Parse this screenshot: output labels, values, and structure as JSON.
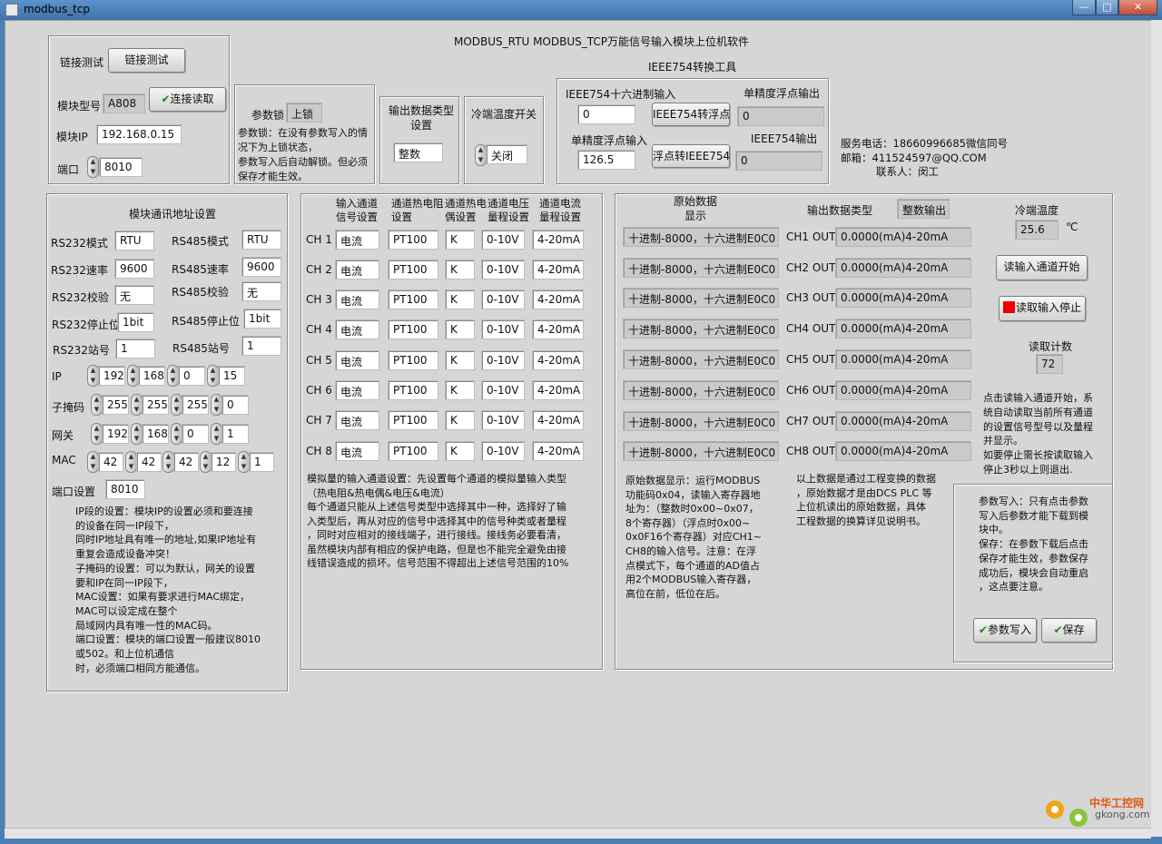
{
  "window": {
    "title": "modbus_tcp",
    "min": "—",
    "max": "□",
    "close": "✕"
  },
  "app_title": "MODBUS_RTU MODBUS_TCP万能信号输入模块上位机软件",
  "conn": {
    "test_label": "链接测试",
    "test_btn": "链接测试",
    "model_label": "模块型号",
    "model": "A808",
    "read_btn": "连接读取",
    "ip_label": "模块IP",
    "ip": "192.168.0.15",
    "port_label": "端口",
    "port": "8010"
  },
  "lock": {
    "label": "参数锁",
    "value": "上锁",
    "desc": "参数锁：在没有参数写入的情况下为上锁状态，\n参数写入后自动解锁。但必须保存才能生效。"
  },
  "out_type": {
    "label": "输出数据类型\n设置",
    "value": "整数"
  },
  "cold": {
    "label": "冷端温度开关",
    "value": "关闭"
  },
  "ieee": {
    "title": "IEEE754转换工具",
    "hex_in_label": "IEEE754十六进制输入",
    "hex_in": "0",
    "to_float_btn": "IEEE754转浮点",
    "float_out_label": "单精度浮点输出",
    "float_out": "0",
    "float_in_label": "单精度浮点输入",
    "float_in": "126.5",
    "to_ieee_btn": "浮点转IEEE754",
    "ieee_out_label": "IEEE754输出",
    "ieee_out": "0"
  },
  "service": {
    "phone": "服务电话：18660996685微信同号",
    "email": "邮箱：411524597@QQ.COM",
    "contact": "联系人：闵工"
  },
  "comm": {
    "title": "模块通讯地址设置",
    "rs232_mode_label": "RS232模式",
    "rs232_mode": "RTU",
    "rs485_mode_label": "RS485模式",
    "rs485_mode": "RTU",
    "rs232_rate_label": "RS232速率",
    "rs232_rate": "9600",
    "rs485_rate_label": "RS485速率",
    "rs485_rate": "9600",
    "rs232_check_label": "RS232校验",
    "rs232_check": "无",
    "rs485_check_label": "RS485校验",
    "rs485_check": "无",
    "rs232_stop_label": "RS232停止位",
    "rs232_stop": "1bit",
    "rs485_stop_label": "RS485停止位",
    "rs485_stop": "1bit",
    "rs232_addr_label": "RS232站号",
    "rs232_addr": "1",
    "rs485_addr_label": "RS485站号",
    "rs485_addr": "1",
    "ip_label": "IP",
    "ip": [
      "192",
      "168",
      "0",
      "15"
    ],
    "mask_label": "子掩码",
    "mask": [
      "255",
      "255",
      "255",
      "0"
    ],
    "gw_label": "网关",
    "gw": [
      "192",
      "168",
      "0",
      "1"
    ],
    "mac_label": "MAC",
    "mac": [
      "42",
      "42",
      "42",
      "12",
      "1"
    ],
    "port_label": "端口设置",
    "port": "8010",
    "note": "IP段的设置：模块IP的设置必须和要连接\n的设备在同一IP段下，\n同时IP地址具有唯一的地址,如果IP地址有\n重复会造成设备冲突！\n子掩码的设置：可以为默认，网关的设置\n要和IP在同一IP段下，\nMAC设置：如果有要求进行MAC绑定，\nMAC可以设定成在整个\n局域网内具有唯一性的MAC码。\n端口设置：模块的端口设置一般建议8010\n或502。和上位机通信\n时，必须端口相同方能通信。"
  },
  "chcfg": {
    "headers": [
      "输入通道\n信号设置",
      "通道热电阻\n设置",
      "通道热电\n偶设置",
      "通道电压\n量程设置",
      "通道电流\n量程设置"
    ],
    "rows": [
      {
        "ch": "CH 1",
        "sig": "电流",
        "rtd": "PT100",
        "tc": "K",
        "v": "0-10V",
        "i": "4-20mA"
      },
      {
        "ch": "CH 2",
        "sig": "电流",
        "rtd": "PT100",
        "tc": "K",
        "v": "0-10V",
        "i": "4-20mA"
      },
      {
        "ch": "CH 3",
        "sig": "电流",
        "rtd": "PT100",
        "tc": "K",
        "v": "0-10V",
        "i": "4-20mA"
      },
      {
        "ch": "CH 4",
        "sig": "电流",
        "rtd": "PT100",
        "tc": "K",
        "v": "0-10V",
        "i": "4-20mA"
      },
      {
        "ch": "CH 5",
        "sig": "电流",
        "rtd": "PT100",
        "tc": "K",
        "v": "0-10V",
        "i": "4-20mA"
      },
      {
        "ch": "CH 6",
        "sig": "电流",
        "rtd": "PT100",
        "tc": "K",
        "v": "0-10V",
        "i": "4-20mA"
      },
      {
        "ch": "CH 7",
        "sig": "电流",
        "rtd": "PT100",
        "tc": "K",
        "v": "0-10V",
        "i": "4-20mA"
      },
      {
        "ch": "CH 8",
        "sig": "电流",
        "rtd": "PT100",
        "tc": "K",
        "v": "0-10V",
        "i": "4-20mA"
      }
    ],
    "note": "模拟量的输入通道设置：先设置每个通道的模拟量输入类型\n（热电阻&热电偶&电压&电流）\n每个通道只能从上述信号类型中选择其中一种，选择好了输\n入类型后，再从对应的信号中选择其中的信号种类或者量程\n，同时对应相对的接线端子，进行接线。接线务必要看清，\n虽然模块内部有相应的保护电路，但是也不能完全避免由接\n线错误造成的损坏。信号范围不得超出上述信号范围的10%"
  },
  "monitor": {
    "raw_title": "原始数据\n显示",
    "out_type_label": "输出数据类型",
    "out_type": "整数输出",
    "cold_label": "冷端温度",
    "cold": "25.6",
    "cold_unit": "℃",
    "rows": [
      {
        "raw": "十进制-8000，十六进制E0C0",
        "ch": "CH1 OUT",
        "out": "0.0000(mA)4-20mA"
      },
      {
        "raw": "十进制-8000，十六进制E0C0",
        "ch": "CH2 OUT",
        "out": "0.0000(mA)4-20mA"
      },
      {
        "raw": "十进制-8000，十六进制E0C0",
        "ch": "CH3 OUT",
        "out": "0.0000(mA)4-20mA"
      },
      {
        "raw": "十进制-8000，十六进制E0C0",
        "ch": "CH4 OUT",
        "out": "0.0000(mA)4-20mA"
      },
      {
        "raw": "十进制-8000，十六进制E0C0",
        "ch": "CH5 OUT",
        "out": "0.0000(mA)4-20mA"
      },
      {
        "raw": "十进制-8000，十六进制E0C0",
        "ch": "CH6 OUT",
        "out": "0.0000(mA)4-20mA"
      },
      {
        "raw": "十进制-8000，十六进制E0C0",
        "ch": "CH7 OUT",
        "out": "0.0000(mA)4-20mA"
      },
      {
        "raw": "十进制-8000，十六进制E0C0",
        "ch": "CH8 OUT",
        "out": "0.0000(mA)4-20mA"
      }
    ],
    "start_btn": "读输入通道开始",
    "stop_btn": "读取输入停止",
    "count_label": "读取计数",
    "count": "72",
    "right_note": "点击读输入通道开始，系\n统自动读取当前所有通道\n的设置信号型号以及量程\n并显示。\n如要停止需长按读取输入\n停止3秒以上则退出.",
    "raw_note": "原始数据显示：运行MODBUS\n功能码0x04，读输入寄存器地\n址为：（整数时0x00~0x07，\n8个寄存器）（浮点时0x00~\n0x0F16个寄存器）对应CH1~\nCH8的输入信号。注意：在浮\n点模式下，每个通道的AD值占\n用2个MODBUS输入寄存器，\n高位在前，低位在后。",
    "eng_note": "以上数据是通过工程变换的数据\n，原始数据才是由DCS PLC 等\n上位机读出的原始数据，具体\n工程数据的换算详见说明书。",
    "param_note": "参数写入：只有点击参数\n写入后参数才能下载到模\n块中。\n保存：在参数下载后点击\n保存才能生效，参数保存\n成功后，模块会自动重启\n，这点要注意。",
    "write_btn": "参数写入",
    "save_btn": "保存"
  },
  "watermark": {
    "cn": "中华工控网",
    "en": "gkong.com"
  }
}
